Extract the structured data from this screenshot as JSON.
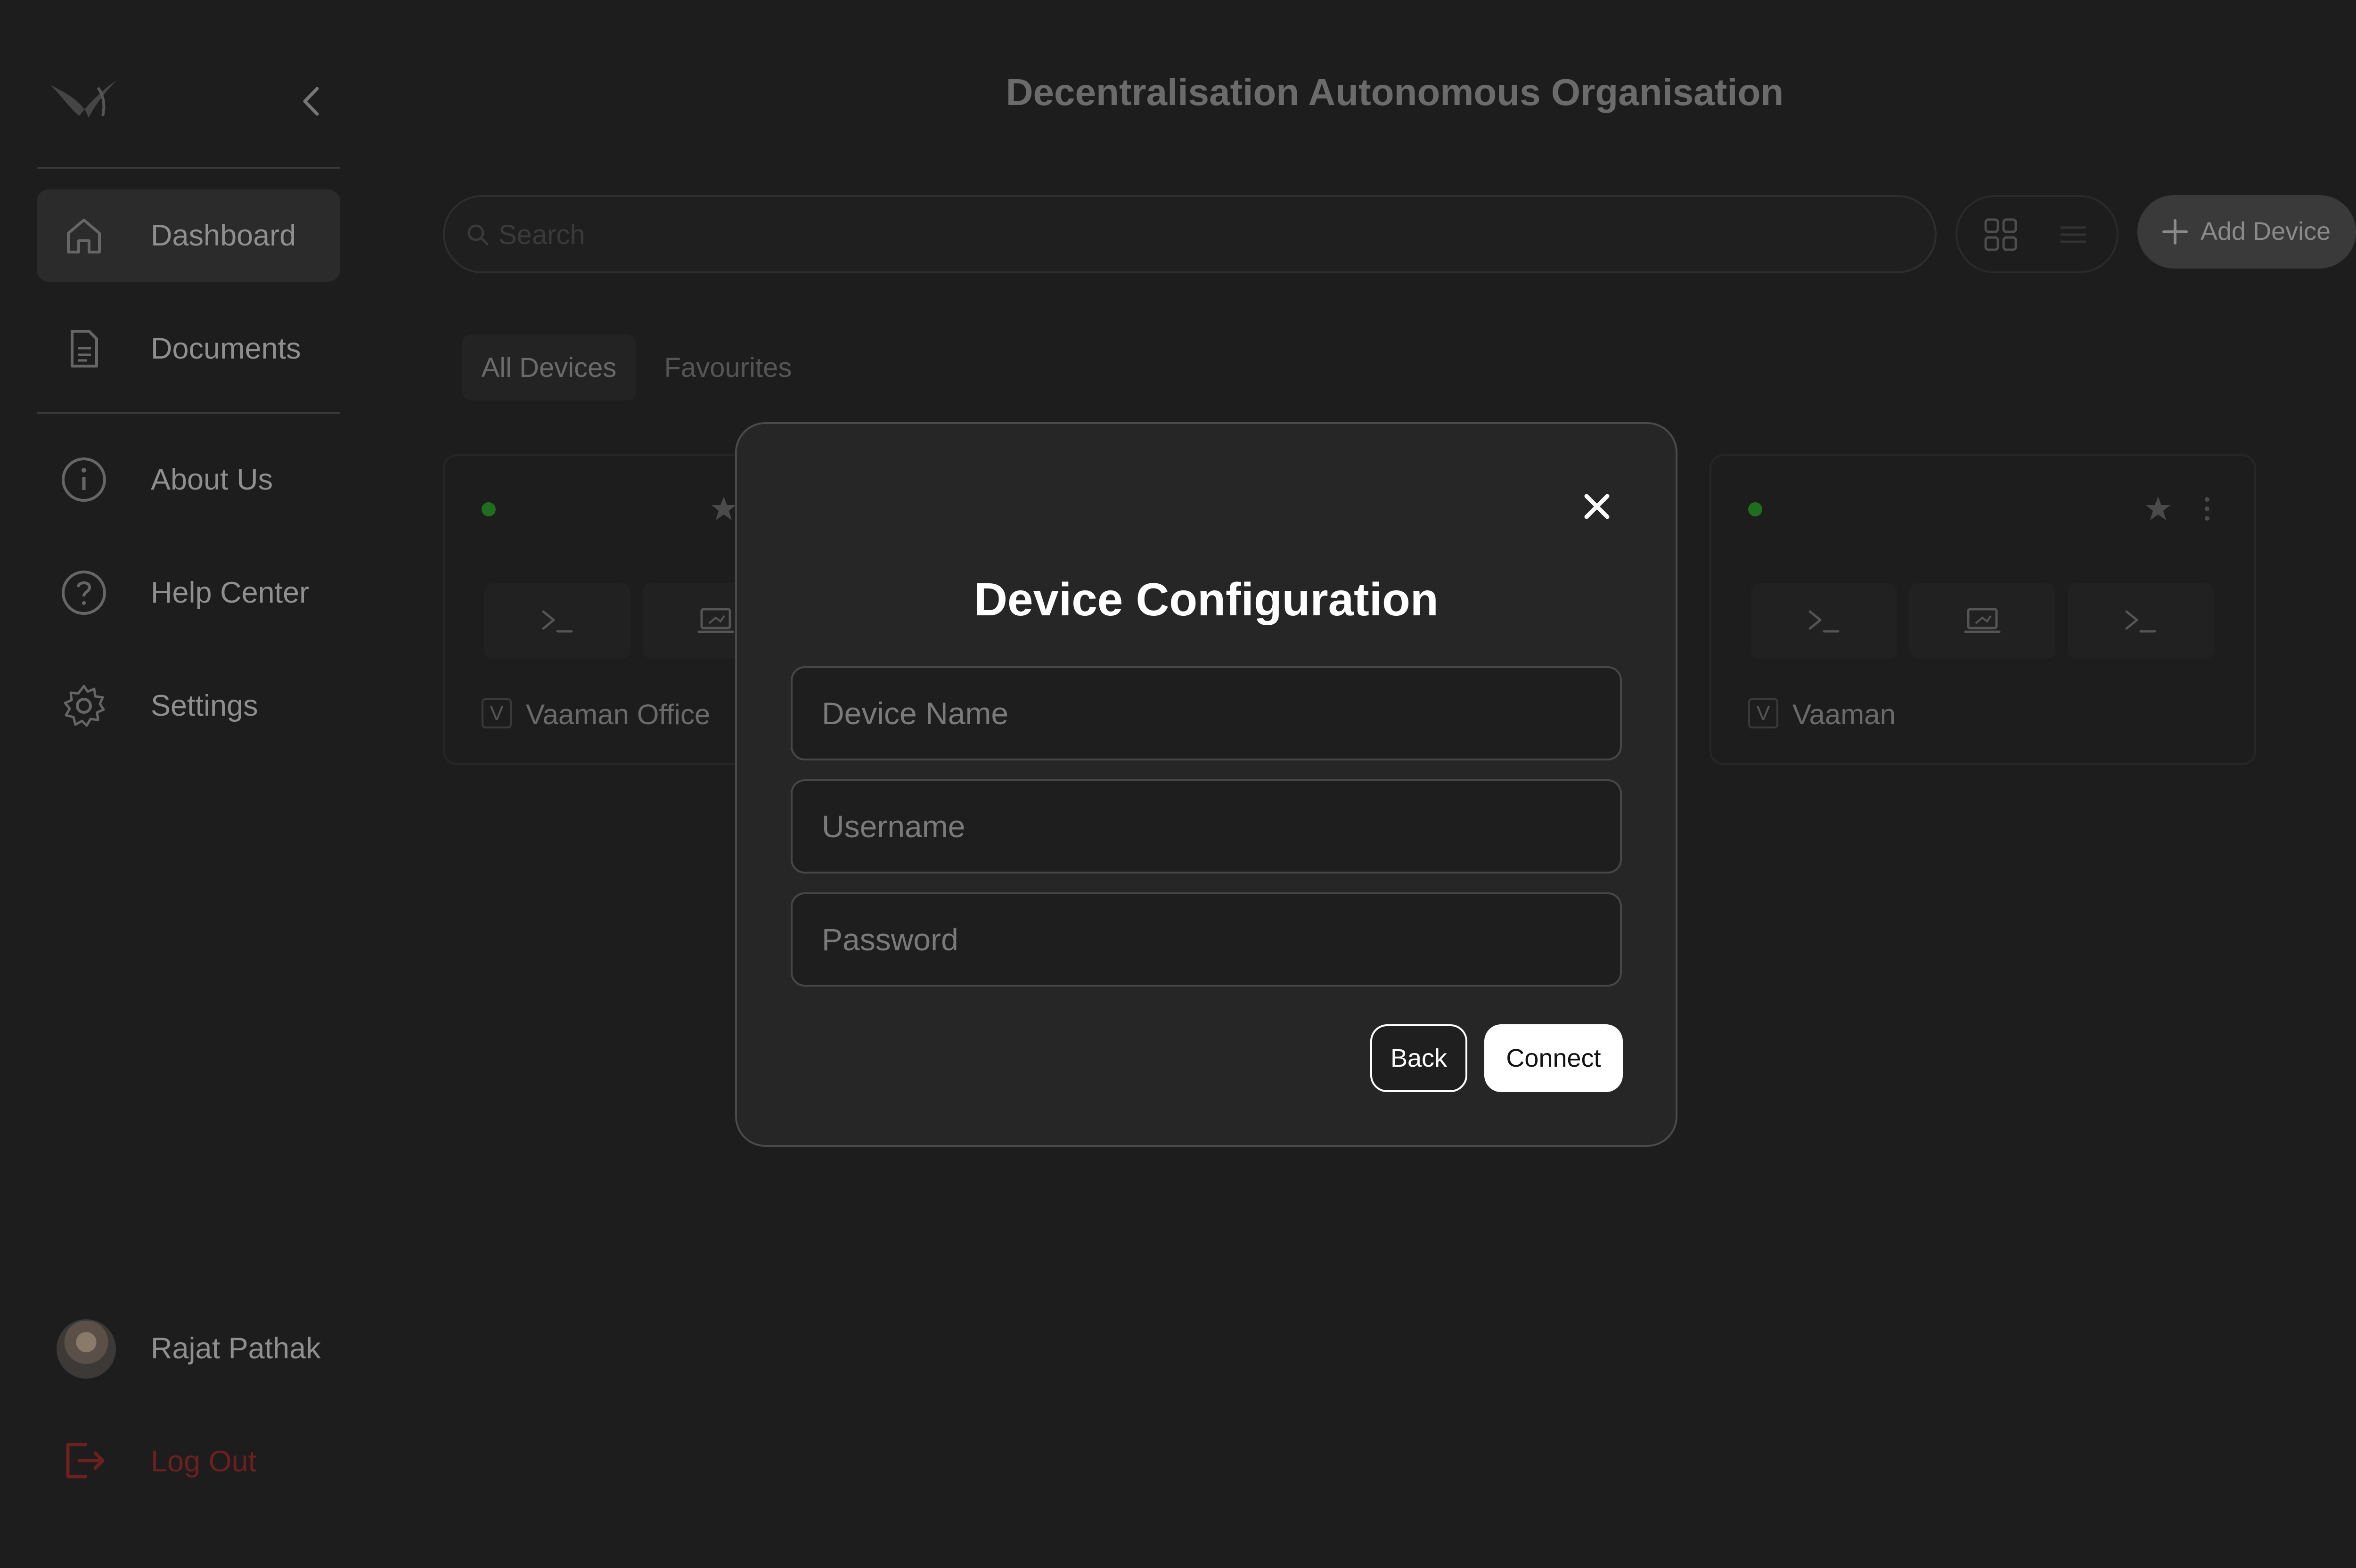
{
  "header": {
    "title": "Decentralisation Autonomous Organisation"
  },
  "sidebar": {
    "items": [
      {
        "label": "Dashboard",
        "icon": "home-icon",
        "active": true
      },
      {
        "label": "Documents",
        "icon": "document-icon",
        "active": false
      },
      {
        "label": "About Us",
        "icon": "info-icon",
        "active": false
      },
      {
        "label": "Help Center",
        "icon": "help-icon",
        "active": false
      },
      {
        "label": "Settings",
        "icon": "gear-icon",
        "active": false
      }
    ],
    "user": {
      "name": "Rajat Pathak"
    },
    "logout_label": "Log Out"
  },
  "toolbar": {
    "search_placeholder": "Search",
    "add_device_label": "Add Device"
  },
  "tabs": [
    {
      "label": "All Devices",
      "active": true
    },
    {
      "label": "Favourites",
      "active": false
    }
  ],
  "devices": [
    {
      "name": "Vaaman Office",
      "badge": "V",
      "status": "online"
    },
    {
      "name": "Vaaman",
      "badge": "V",
      "status": "online"
    }
  ],
  "modal": {
    "title": "Device Configuration",
    "fields": {
      "device_name_placeholder": "Device Name",
      "username_placeholder": "Username",
      "password_placeholder": "Password"
    },
    "back_label": "Back",
    "connect_label": "Connect"
  },
  "colors": {
    "background": "#1d1d1d",
    "modal_background": "#262626",
    "status_online": "#1f6d1f",
    "logout": "#6e1f1f",
    "primary_button": "#ffffff"
  }
}
